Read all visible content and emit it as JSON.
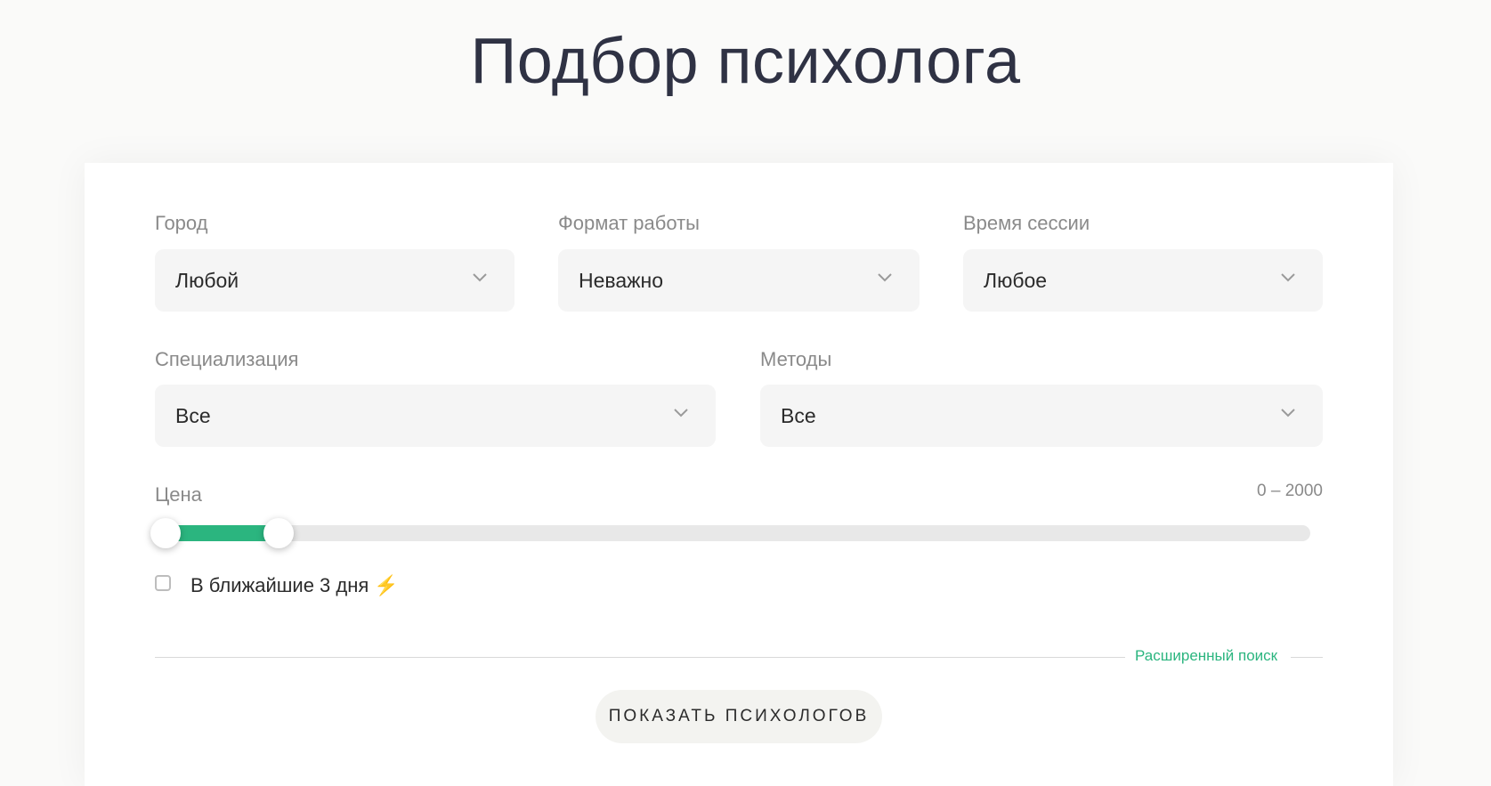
{
  "page": {
    "title": "Подбор психолога"
  },
  "filters": {
    "city": {
      "label": "Город",
      "value": "Любой"
    },
    "format": {
      "label": "Формат работы",
      "value": "Неважно"
    },
    "time": {
      "label": "Время сессии",
      "value": "Любое"
    },
    "specialization": {
      "label": "Специализация",
      "value": "Все"
    },
    "methods": {
      "label": "Методы",
      "value": "Все"
    },
    "price": {
      "label": "Цена",
      "range_text": "0 – 2000",
      "slider_min_fraction": 0.0,
      "slider_max_fraction": 0.1
    },
    "soon": {
      "label": "В ближайшие 3 дня",
      "icon": "⚡",
      "checked": false
    }
  },
  "advanced_search": "Расширенный поиск",
  "submit_label": "ПОКАЗАТЬ ПСИХОЛОГОВ",
  "colors": {
    "accent": "#2bb57f",
    "title": "#2f3244"
  }
}
